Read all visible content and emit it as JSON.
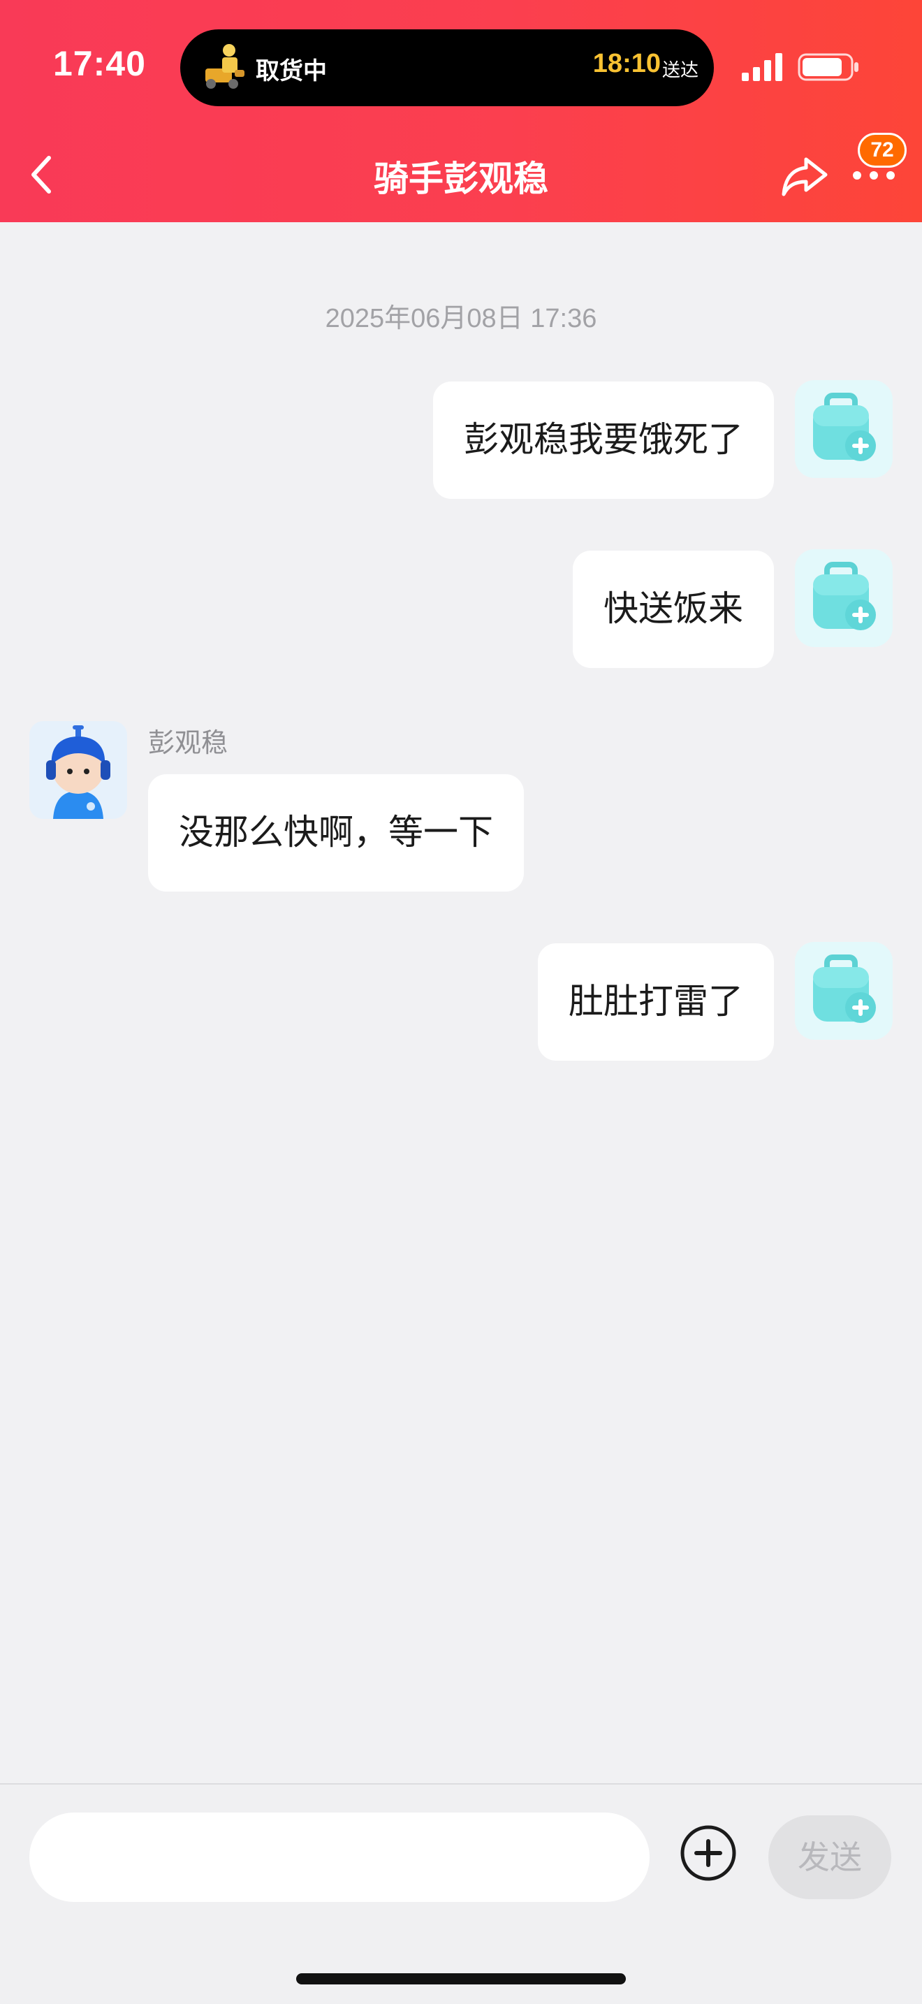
{
  "status_bar": {
    "time": "17:40",
    "live_activity": {
      "status": "取货中",
      "eta_time": "18:10",
      "eta_label": "送达"
    }
  },
  "nav": {
    "title": "骑手彭观稳",
    "badge_count": "72"
  },
  "chat": {
    "timestamp": "2025年06月08日 17:36",
    "messages": [
      {
        "sender": "me",
        "text": "彭观稳我要饿死了"
      },
      {
        "sender": "me",
        "text": "快送饭来"
      },
      {
        "sender": "rider",
        "sender_name": "彭观稳",
        "text": "没那么快啊，等一下"
      },
      {
        "sender": "me",
        "text": "肚肚打雷了"
      }
    ]
  },
  "input": {
    "send_label": "发送"
  },
  "colors": {
    "header_gradient_start": "#f93a57",
    "header_gradient_end": "#fd4538",
    "badge": "#ff6a00",
    "eta": "#f9c232",
    "bubble": "#ffffff",
    "background": "#f1f1f3"
  },
  "icons": {
    "back": "chevron-left-icon",
    "share": "share-arrow-icon",
    "more": "more-dots-icon",
    "add": "plus-circle-icon",
    "signal": "cellular-signal-icon",
    "battery": "battery-icon"
  }
}
